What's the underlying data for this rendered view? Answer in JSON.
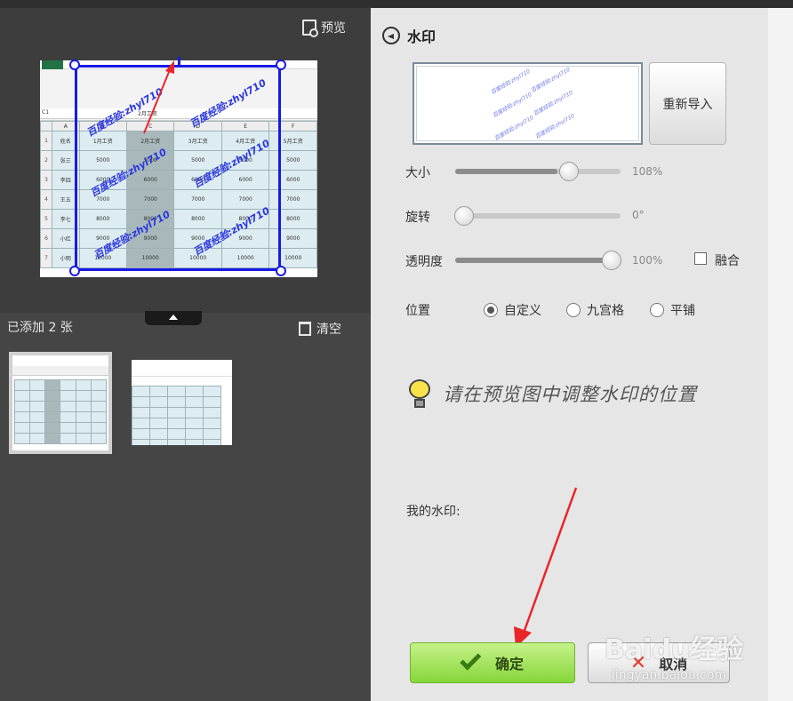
{
  "left": {
    "preview_label": "预览",
    "added_label": "已添加 2 张",
    "clear_label": "清空",
    "sheet": {
      "cell_ref": "C1",
      "formula": "2月工资",
      "headers": [
        "姓名",
        "1月工资",
        "2月工资",
        "3月工资",
        "4月工资",
        "5月工资"
      ],
      "rows": [
        {
          "num": "1",
          "cells": [
            "姓名",
            "1月工资",
            "2月工资",
            "3月工资",
            "4月工资",
            "5月工资"
          ]
        },
        {
          "num": "2",
          "cells": [
            "张三",
            "5000",
            "5000",
            "5000",
            "5000",
            "5000"
          ]
        },
        {
          "num": "3",
          "cells": [
            "李四",
            "6000",
            "6000",
            "6000",
            "6000",
            "6000"
          ]
        },
        {
          "num": "4",
          "cells": [
            "王五",
            "7000",
            "7000",
            "7000",
            "7000",
            "7000"
          ]
        },
        {
          "num": "5",
          "cells": [
            "李七",
            "8000",
            "8000",
            "8000",
            "8000",
            "8000"
          ]
        },
        {
          "num": "6",
          "cells": [
            "小红",
            "9000",
            "9000",
            "9000",
            "9000",
            "9000"
          ]
        },
        {
          "num": "7",
          "cells": [
            "小明",
            "10000",
            "10000",
            "10000",
            "10000",
            "10000"
          ]
        }
      ],
      "watermark_text": "百度经验:zhyl710"
    }
  },
  "panel": {
    "title": "水印",
    "reimport_label": "重新导入",
    "preview_watermark": "百度经验:zhyl710",
    "size": {
      "label": "大小",
      "value": "108%",
      "level": 0.62
    },
    "rotate": {
      "label": "旋转",
      "value": "0°",
      "level": 0.0
    },
    "opacity": {
      "label": "透明度",
      "value": "100%",
      "level": 1.0
    },
    "blend_label": "融合",
    "position": {
      "label": "位置",
      "options": [
        "自定义",
        "九宫格",
        "平铺"
      ],
      "selected": "自定义"
    },
    "tip": "请在预览图中调整水印的位置",
    "my_watermark_label": "我的水印:",
    "ok_label": "确定",
    "cancel_label": "取消"
  },
  "overlay": {
    "brand": "Baidu经验",
    "brand_sub": "jingyan.baidu.com"
  },
  "colors": {
    "watermark_frame": "#1919e6",
    "ok_green": "#86d63a",
    "arrow_red": "#e8262a"
  }
}
